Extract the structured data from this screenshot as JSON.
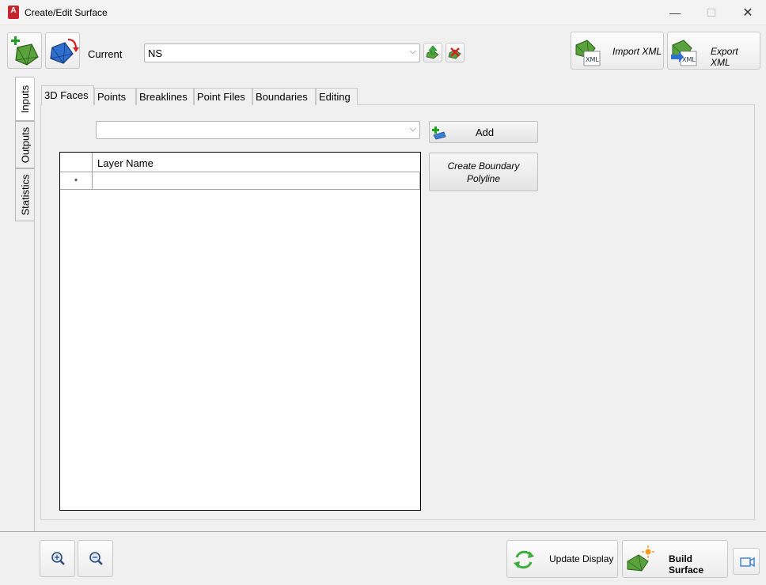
{
  "window": {
    "title": "Create/Edit Surface",
    "app_icon_letter": "A",
    "minimize_glyph": "—",
    "maximize_glyph": "☐",
    "close_glyph": "✕"
  },
  "toolbar": {
    "current_label": "Current",
    "current_value": "NS",
    "import_label": "Import XML",
    "export_label": "Export XML",
    "xml_badge": "XML"
  },
  "side_tabs": [
    "Inputs",
    "Outputs",
    "Statistics"
  ],
  "tabs": [
    "3D Faces",
    "Points",
    "Breaklines",
    "Point Files",
    "Boundaries",
    "Editing"
  ],
  "faces_panel": {
    "layer_select_value": "",
    "add_label": "Add",
    "create_boundary_line1": "Create Boundary",
    "create_boundary_line2": "Polyline",
    "grid": {
      "column_header": "Layer Name",
      "new_row_marker": "*"
    }
  },
  "bottom": {
    "update_display_label": "Update Display",
    "build_surface_label": "Build Surface"
  },
  "colors": {
    "surface_green": "#5aa23c",
    "surface_blue": "#2f6fcf",
    "add_green": "#1ea11e",
    "delete_red": "#d22424",
    "app_red": "#c4262e"
  }
}
